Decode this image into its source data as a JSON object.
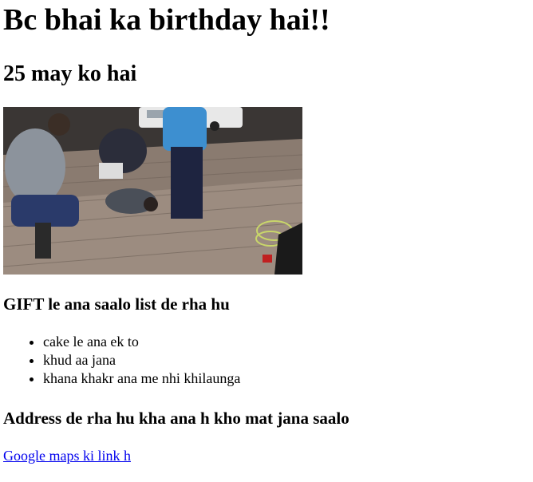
{
  "heading": "Bc bhai ka birthday hai!!",
  "date_heading": "25 may ko hai",
  "photo": {
    "icon": "photo-group-celebration"
  },
  "gift": {
    "heading": "GIFT le ana saalo list de rha hu",
    "items": [
      "cake le ana ek to",
      "khud aa jana",
      "khana khakr ana me nhi khilaunga"
    ]
  },
  "address": {
    "heading": "Address de rha hu kha ana h kho mat jana saalo",
    "link_label": "Google maps ki link h"
  },
  "colors": {
    "link": "#0000ee",
    "text": "#000000",
    "background": "#ffffff"
  }
}
